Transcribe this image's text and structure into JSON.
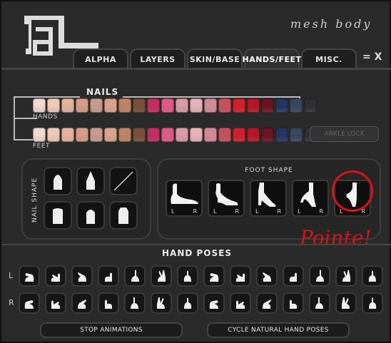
{
  "header": {
    "title": "mesh body",
    "close_label": "= X"
  },
  "tabs": [
    {
      "label": "ALPHA"
    },
    {
      "label": "LAYERS"
    },
    {
      "label": "SKIN/BASE"
    },
    {
      "label": "HANDS/FEET",
      "active": true
    },
    {
      "label": "MISC."
    }
  ],
  "nails": {
    "title": "NAILS",
    "hands_label": "HANDS",
    "feet_label": "FEET",
    "ankle_lock": "ANKLE LOCK",
    "hand_colors": [
      "#f3d8cc",
      "#f0c9b8",
      "#e6b29c",
      "#d79c84",
      "#c99b8a",
      "#d8a48a",
      "#c08464",
      "#7a5038",
      "#c42c62",
      "#e05a86",
      "#d99aa6",
      "#e8b1b8",
      "#d38a98",
      "#c8505c",
      "#d0202a",
      "#b41824",
      "#6a1420",
      "#243660",
      "#3a4660",
      "#2e2e34"
    ],
    "feet_colors": [
      "#f3d8cc",
      "#f0c9b8",
      "#e6b29c",
      "#d79c84",
      "#c99b8a",
      "#d8a48a",
      "#c08464",
      "#7a5038",
      "#c42c62",
      "#e05a86",
      "#d99aa6",
      "#e8b1b8",
      "#d38a98",
      "#c8505c",
      "#d0202a",
      "#b41824",
      "#6a1420",
      "#243660",
      "#3a4660",
      "#2e2e34"
    ]
  },
  "nail_shape": {
    "title": "NAIL SHAPE",
    "shapes": [
      "almond",
      "stiletto",
      "none",
      "square-round",
      "oval",
      "coffin"
    ]
  },
  "foot_shape": {
    "title": "FOOT SHAPE",
    "buttons": [
      {
        "name": "flat",
        "l": "L",
        "r": "R"
      },
      {
        "name": "low-heel",
        "l": "L",
        "r": "R"
      },
      {
        "name": "mid-heel",
        "l": "L",
        "r": "R"
      },
      {
        "name": "high-heel",
        "l": "L",
        "r": "R"
      },
      {
        "name": "pointe",
        "l": "L",
        "r": "R"
      }
    ],
    "annotation": "Pointe!"
  },
  "hand_poses": {
    "title": "HAND POSES",
    "left_label": "L",
    "right_label": "R",
    "pose_count": 14
  },
  "buttons": {
    "stop": "STOP ANIMATIONS",
    "cycle": "CYCLE NATURAL HAND POSES"
  }
}
